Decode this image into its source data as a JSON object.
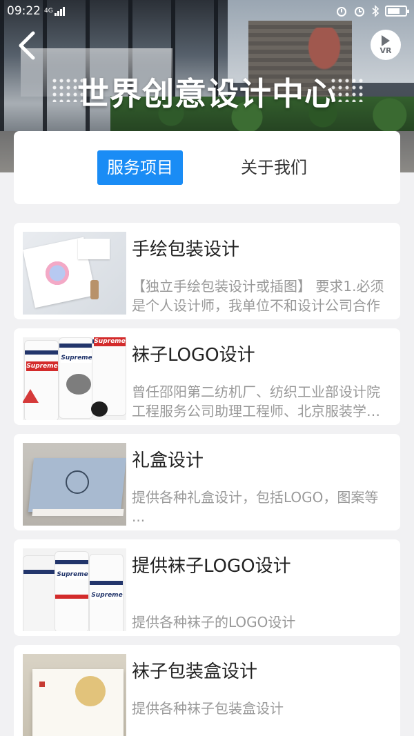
{
  "status_bar": {
    "time": "09:22",
    "network": "4G",
    "indicators": [
      "alarm-icon",
      "clock-icon",
      "bluetooth-icon"
    ],
    "battery_level": 0.7
  },
  "header": {
    "title": "世界创意设计中心",
    "back_icon": "chevron-left-icon",
    "vr_label": "VR"
  },
  "tabs": [
    {
      "label": "服务项目",
      "active": true
    },
    {
      "label": "关于我们",
      "active": false
    }
  ],
  "services": [
    {
      "title": "手绘包装设计",
      "description": "【独立手绘包装设计或插图】 要求1.必须是个人设计师，我单位不和设计公司合作",
      "thumbnail": "hand-drawn-packaging"
    },
    {
      "title": "袜子LOGO设计",
      "description": "曾任邵阳第二纺机厂、纺织工业部设计院工程服务公司助理工程师、北京服装学院教师",
      "thumbnail": "socks-logo",
      "sock_logo_text": "Supreme"
    },
    {
      "title": "礼盒设计",
      "description": "提供各种礼盒设计，包括LOGO，图案等 ...",
      "thumbnail": "gift-box"
    },
    {
      "title": "提供袜子LOGO设计",
      "description": "提供各种袜子的LOGO设计",
      "thumbnail": "socks-logo-2",
      "sock_logo_text": "Supreme"
    },
    {
      "title": "袜子包装盒设计",
      "description": "提供各种袜子包装盒设计",
      "thumbnail": "sock-packaging-box"
    }
  ]
}
